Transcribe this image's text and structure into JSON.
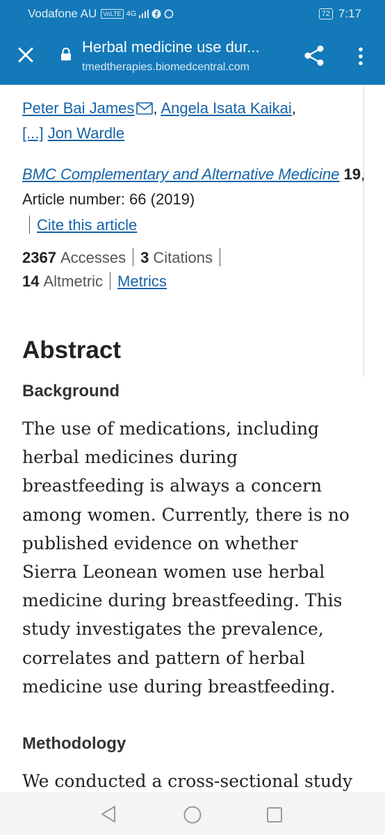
{
  "status_bar": {
    "carrier": "Vodafone AU",
    "volte": "VoLTE",
    "network": "4G",
    "battery": "72",
    "time": "7:17"
  },
  "toolbar": {
    "title": "Herbal medicine use dur...",
    "url": "tmedtherapies.biomedcentral.com",
    "icons": [
      "close-icon",
      "lock-icon",
      "share-icon",
      "more-vert-icon"
    ]
  },
  "article": {
    "authors": [
      {
        "name": "Peter Bai James",
        "has_email": true
      },
      {
        "name": "Angela Isata Kaikai",
        "has_email": false
      }
    ],
    "ellipsis": "[...]",
    "last_author": "Jon Wardle",
    "journal": "BMC Complementary and Alternative Medicine",
    "volume": "19",
    "article_number_text": ", Article number: 66 (2019)",
    "cite_label": "Cite this article",
    "accesses_count": "2367",
    "accesses_label": "Accesses",
    "citations_count": "3",
    "citations_label": "Citations",
    "altmetric_count": "14",
    "altmetric_label": "Altmetric",
    "metrics_label": "Metrics"
  },
  "abstract": {
    "heading": "Abstract",
    "background_heading": "Background",
    "background_lines": [
      "The use of medications, including",
      "herbal medicines during",
      "breastfeeding is always a concern",
      "among women. Currently, there is no",
      "published evidence on whether",
      "Sierra Leonean women use herbal",
      "medicine during breastfeeding. This",
      "study investigates the prevalence,",
      "correlates and pattern of herbal",
      "medicine use during breastfeeding."
    ],
    "methodology_heading": "Methodology",
    "methodology_text": "We conducted a cross-sectional study"
  },
  "nav_bar": {
    "icons": [
      "back-icon",
      "home-icon",
      "recents-icon"
    ]
  },
  "colors": {
    "toolbar": "#1379b9",
    "link": "#1663a8",
    "text": "#222222"
  }
}
